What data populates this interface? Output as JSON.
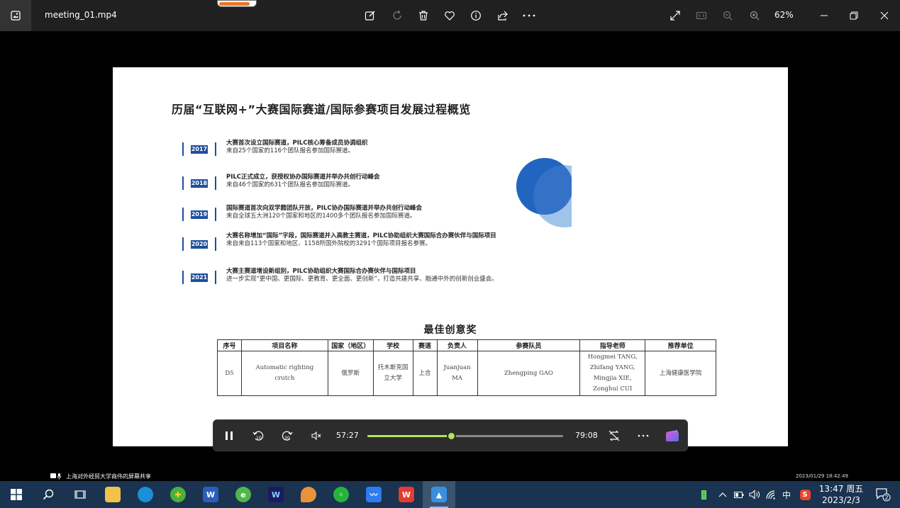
{
  "window": {
    "filename": "meeting_01.mp4",
    "zoom": "62%",
    "load_progress": 0.82
  },
  "slide": {
    "title": "历届“互联网+”大赛国际赛道/国际参赛项目发展过程概览",
    "timeline": [
      {
        "year": "2017",
        "head": "大赛首次设立国际赛道，PILC核心筹备成员协调组织",
        "sub": "来自25个国家的116个团队报名参加国际赛道。"
      },
      {
        "year": "2018",
        "head": "PILC正式成立，获授权协办国际赛道并举办共创行动峰会",
        "sub": "来自46个国家的631个团队报名参加国际赛道。"
      },
      {
        "year": "2019",
        "head": "国际赛道首次向双学籍团队开放，PILC协办国际赛道并举办共创行动峰会",
        "sub": "来自全球五大洲120个国家和地区的1400多个团队报名参加国际赛道。"
      },
      {
        "year": "2020",
        "head": "大赛名称增加“国际”字段，国际赛道并入高教主赛道，PILC协助组织大赛国际合办赛伙伴与国际项目",
        "sub": "来自来自113个国家和地区、1158所国外院校的3291个国际项目报名参赛。"
      },
      {
        "year": "2021",
        "head": "大赛主赛道增设新组别，PILC协助组织大赛国际合办赛伙伴与国际项目",
        "sub": "进一步实现“更中国、更国际、更教育、更全面、更创新”，打造共建共享、融通中外的创新创业盛会。"
      }
    ],
    "award_title": "最佳创意奖",
    "table": {
      "headers": [
        "序号",
        "项目名称",
        "国家（地区）",
        "学校",
        "赛道",
        "负责人",
        "参赛队员",
        "指导老师",
        "推荐单位"
      ],
      "rows": [
        [
          "D5",
          "Automatic righting crutch",
          "俄罗斯",
          "托木斯克国立大学",
          "上合",
          "Juanjuan MA",
          "Zhengping GAO",
          "Hongmei TANG, Zhifang YANG, Mingjia XIE, Zonghui CUI",
          "上海健康医学院"
        ]
      ]
    }
  },
  "player": {
    "current_time": "57:27",
    "total_time": "79:08",
    "progress": 0.426
  },
  "share_caption": "上海对外经贸大学商伟的屏幕共享",
  "recording_timestamp": "2023/01/29 18:42:49",
  "taskbar": {
    "time": "13:47 周五",
    "date": "2023/2/3",
    "ime": "中",
    "notifications": "2"
  },
  "colors": {
    "accent_blue": "#1f4e9c",
    "seek_green": "#b4e35c",
    "taskbar_bg": "#1a3350"
  }
}
